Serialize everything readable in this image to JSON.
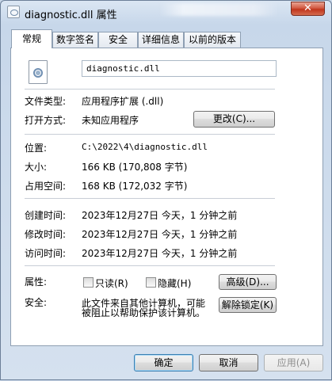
{
  "window": {
    "title": "diagnostic.dll 属性",
    "close_label": "✕"
  },
  "tabs": [
    {
      "label": "常规",
      "active": true
    },
    {
      "label": "数字签名",
      "active": false
    },
    {
      "label": "安全",
      "active": false
    },
    {
      "label": "详细信息",
      "active": false
    },
    {
      "label": "以前的版本",
      "active": false
    }
  ],
  "general": {
    "file_name": "diagnostic.dll",
    "file_icon": "dll-gear-icon",
    "file_type_label": "文件类型:",
    "file_type_value": "应用程序扩展 (.dll)",
    "opens_with_label": "打开方式:",
    "opens_with_value": "未知应用程序",
    "change_button": "更改(C)...",
    "location_label": "位置:",
    "location_value": "C:\\2022\\4\\diagnostic.dll",
    "size_label": "大小:",
    "size_value": "166 KB (170,808 字节)",
    "size_on_disk_label": "占用空间:",
    "size_on_disk_value": "168 KB (172,032 字节)",
    "created_label": "创建时间:",
    "created_value": "2023年12月27日 今天，1 分钟之前",
    "modified_label": "修改时间:",
    "modified_value": "2023年12月27日 今天，1 分钟之前",
    "accessed_label": "访问时间:",
    "accessed_value": "2023年12月27日 今天，1 分钟之前",
    "attributes_label": "属性:",
    "readonly_label": "只读(R)",
    "readonly_checked": false,
    "hidden_label": "隐藏(H)",
    "hidden_checked": false,
    "advanced_button": "高级(D)...",
    "security_label": "安全:",
    "security_text_line1": "此文件来自其他计算机，可能",
    "security_text_line2": "被阻止以帮助保护该计算机。",
    "unblock_button": "解除锁定(K)"
  },
  "footer": {
    "ok": "确定",
    "cancel": "取消",
    "apply": "应用(A)"
  }
}
